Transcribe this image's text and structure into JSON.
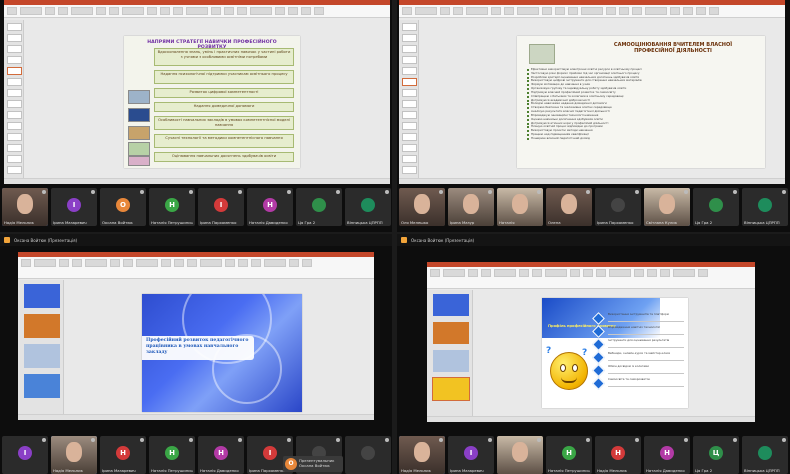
{
  "q1": {
    "slide": {
      "title": "НАПРЯМИ СТРАТЕГІЇ НАВИЧКИ ПРОФЕСІЙНОГО РОЗВИТКУ",
      "boxes": [
        "Вдосконалення знань, умінь і практичних навичок у частині роботи з учнями з особливими освітніми потребами",
        "Надання психологічної підтримки учасникам освітнього процесу",
        "Розвиток цифрової компетентності",
        "Надання домедичної допомоги",
        "Особливості навчальних закладів в умовах компетентнісної моделі навчання",
        "Сучасні технології та методики компетентнісного навчання",
        "Оцінювання навчальних досягнень здобувачів освіти"
      ]
    },
    "participants": [
      {
        "name": "Надія Мельник",
        "initial": "",
        "color": "",
        "camera": true,
        "active": true
      },
      {
        "name": "Ірина Мазаревич",
        "initial": "І",
        "color": "#8a3fc6"
      },
      {
        "name": "Оксана Войтюк",
        "initial": "О",
        "color": "#e8873a"
      },
      {
        "name": "Наталія Петрушинська",
        "initial": "Н",
        "color": "#3aa646"
      },
      {
        "name": "Ірина Пархоменко",
        "initial": "І",
        "color": "#d33a3a"
      },
      {
        "name": "Наталія Давиденко",
        "initial": "Н",
        "color": "#b23aa6"
      },
      {
        "name": "Ця Гра 2",
        "initial": "",
        "color": "#2f8f4a"
      },
      {
        "name": "Вінницька ЦПРПП",
        "initial": "",
        "color": "#1e8c5c"
      }
    ]
  },
  "q2": {
    "slide": {
      "title": "САМООЦІНЮВАННЯ ВЧИТЕЛЕМ ВЛАСНОЇ ПРОФЕСІЙНОЇ ДІЯЛЬНОСТІ",
      "items": [
        "Ефективно використовую електронні освітні ресурси в освітньому процесі",
        "Застосовую різні форми і прийоми під час організації освітнього процесу",
        "Розробляю критерії оцінювання навчальних досягнень здобувачів освіти",
        "Використовую цифрові інструменти для створення навчальних матеріалів",
        "Формую мотивацію до навчання в учнів",
        "Організовую групову та індивідуальну роботу здобувачів освіти",
        "Підтримую власний професійний розвиток та самоосвіту",
        "Співпрацюю з батьками та колегами в освітньому середовищі",
        "Дотримуюся академічної доброчесності",
        "Володію навичками надання домедичної допомоги",
        "Створюю безпечне та інклюзивне освітнє середовище",
        "Аналізую результати власної педагогічної діяльності",
        "Впроваджую інноваційні технології навчання",
        "Оцінюю навчальні досягнення здобувачів освіти",
        "Дотримуюся етичних норм у професійній діяльності",
        "Планую освітній процес відповідно до програми",
        "Використовую проєктні методи навчання",
        "Працюю над підвищенням кваліфікації",
        "Поширюю власний педагогічний досвід"
      ]
    },
    "participants": [
      {
        "name": "Оля Мелешко",
        "camera": true
      },
      {
        "name": "Ірина Мазур",
        "camera": true
      },
      {
        "name": "Наталія",
        "camera": true
      },
      {
        "name": "Олена",
        "camera": true
      },
      {
        "name": "Ірина Пархоменко",
        "initial": "",
        "color": "#444"
      },
      {
        "name": "Світлана Кулик",
        "camera": true,
        "active": true
      },
      {
        "name": "Ця Гра 2",
        "initial": "",
        "color": "#2f8f4a"
      },
      {
        "name": "Вінницька ЦПРПП",
        "initial": "",
        "color": "#1e8c5c"
      }
    ]
  },
  "q3": {
    "presenter": "Оксана Войтюк (Презентація)",
    "slide": {
      "text": "Професійний розвиток педагогічного працівника в умовах навчального закладу"
    },
    "participants": [
      {
        "name": "",
        "initial": "І",
        "color": "#8a3fc6"
      },
      {
        "name": "Надія Мельник",
        "camera": true,
        "active": true
      },
      {
        "name": "Ірина Мазаревич",
        "initial": "Н",
        "color": "#d33a3a"
      },
      {
        "name": "Наталія Петрушинська",
        "initial": "Н",
        "color": "#3aa646"
      },
      {
        "name": "Наталія Давиденко",
        "initial": "Н",
        "color": "#b23aa6"
      },
      {
        "name": "Ірина Пархоменко",
        "initial": "І",
        "color": "#d33a3a"
      },
      {
        "name": "",
        "initial": "",
        "color": "#444"
      },
      {
        "name": "",
        "initial": "",
        "color": "#444"
      }
    ],
    "overlay": {
      "initial": "О",
      "name": "Презентувальник Оксана Войтюк"
    }
  },
  "q4": {
    "presenter": "Оксана Войтюк (Презентація)",
    "slide": {
      "label": "Профіль професійного розвитку",
      "items": [
        "Використання інструментів та платформ",
        "Впровадження новітніх технологій",
        "Інструменти для оцінювання результатів",
        "Вебінари, онлайн-курси та майстер-класи",
        "Обмін досвідом із колегами",
        "Самоосвіта та саморозвиток"
      ]
    },
    "participants": [
      {
        "name": "Надія Мельник",
        "camera": true,
        "active": true
      },
      {
        "name": "Ірина Мазаревич",
        "initial": "І",
        "color": "#8a3fc6"
      },
      {
        "name": "",
        "camera": true
      },
      {
        "name": "Наталія Петрушинська",
        "initial": "Н",
        "color": "#3aa646"
      },
      {
        "name": "Надія Мельник",
        "initial": "Н",
        "color": "#d33a3a"
      },
      {
        "name": "Наталія Давиденко",
        "initial": "Н",
        "color": "#b23aa6"
      },
      {
        "name": "Ця Гра 2",
        "initial": "Ц",
        "color": "#2f8f4a"
      },
      {
        "name": "Вінницька ЦПРПП",
        "initial": "",
        "color": "#1e8c5c"
      }
    ]
  }
}
